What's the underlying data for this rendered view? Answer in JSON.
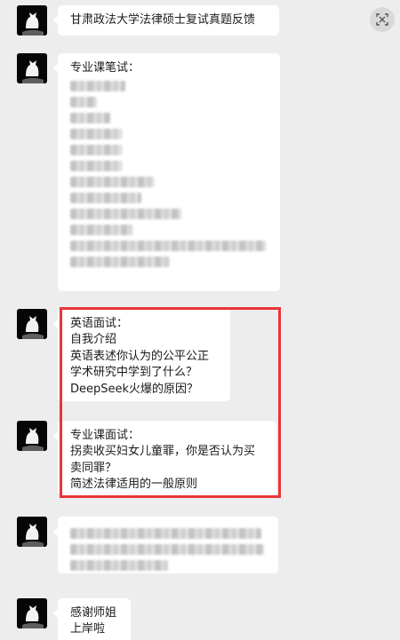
{
  "header_message": {
    "text": "甘肃政法大学法律硕士复试真题反馈"
  },
  "written_exam": {
    "title": "专业课笔试：",
    "blurred_line_count": 12
  },
  "english_interview": {
    "title": "英语面试：",
    "lines": [
      "自我介绍",
      "英语表述你认为的公平公正",
      "学术研究中学到了什么？",
      "DeepSeek火爆的原因？"
    ]
  },
  "major_interview": {
    "title": "专业课面试：",
    "lines": [
      "拐卖收买妇女儿童罪，你是否认为买",
      "卖同罪？",
      "简述法律适用的一般原则"
    ]
  },
  "blurred_message": {
    "blurred_line_count": 3
  },
  "thanks_message": {
    "lines": [
      "感谢师姐",
      "上岸啦"
    ]
  },
  "icons": {
    "top_right": "image-scan-icon",
    "avatar": "cat-avatar-icon"
  },
  "colors": {
    "highlight": "#e8353a",
    "background": "#ededed",
    "bubble": "#ffffff"
  }
}
